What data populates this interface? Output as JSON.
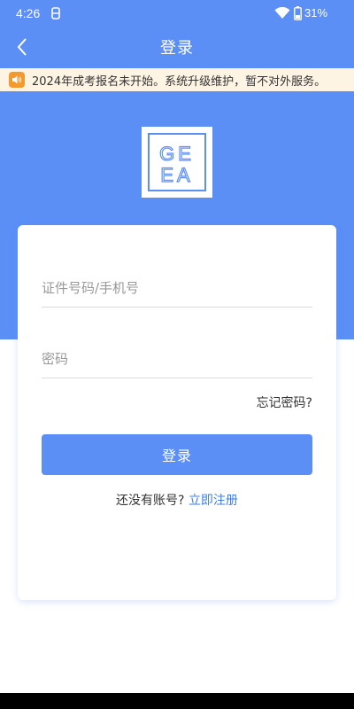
{
  "status_bar": {
    "time": "4:26",
    "battery_percent": "31%"
  },
  "nav": {
    "title": "登录"
  },
  "notice": {
    "text": "2024年成考报名未开始。系统升级维护，暂不对外服务。"
  },
  "logo": {
    "text_lines": [
      "GE",
      "EA"
    ]
  },
  "form": {
    "id_placeholder": "证件号码/手机号",
    "password_placeholder": "密码",
    "forgot_label": "忘记密码?",
    "login_label": "登录",
    "register_prompt": "还没有账号?",
    "register_link": "立即注册"
  },
  "colors": {
    "primary": "#5b8ff6",
    "link": "#3f7ee8",
    "notice_bg": "#fdf4e4",
    "notice_icon": "#f39a2e"
  },
  "icons": {
    "back": "chevron-left-icon",
    "notice": "speaker-icon",
    "wifi": "wifi-icon",
    "battery": "battery-icon"
  }
}
